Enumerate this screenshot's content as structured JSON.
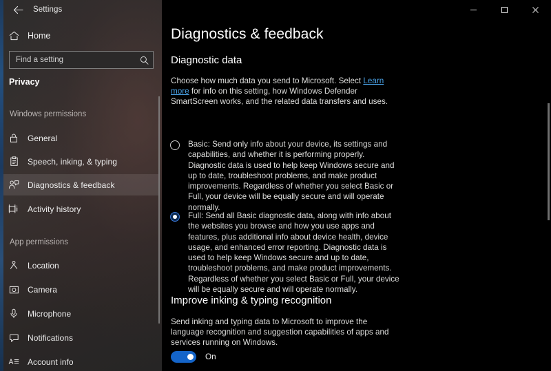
{
  "window": {
    "title": "Settings",
    "back_icon": "back-arrow-icon",
    "controls": {
      "minimize": "minimize-icon",
      "maximize": "maximize-icon",
      "close": "close-icon"
    }
  },
  "sidebar": {
    "home_label": "Home",
    "home_icon": "home-icon",
    "search": {
      "placeholder": "Find a setting",
      "value": "",
      "icon": "search-icon"
    },
    "category": "Privacy",
    "groups": [
      {
        "label": "Windows permissions",
        "items": [
          {
            "label": "General",
            "icon": "lock-icon",
            "selected": false
          },
          {
            "label": "Speech, inking, & typing",
            "icon": "clipboard-icon",
            "selected": false
          },
          {
            "label": "Diagnostics & feedback",
            "icon": "person-feedback-icon",
            "selected": true
          },
          {
            "label": "Activity history",
            "icon": "activity-history-icon",
            "selected": false
          }
        ]
      },
      {
        "label": "App permissions",
        "items": [
          {
            "label": "Location",
            "icon": "location-icon",
            "selected": false
          },
          {
            "label": "Camera",
            "icon": "camera-icon",
            "selected": false
          },
          {
            "label": "Microphone",
            "icon": "microphone-icon",
            "selected": false
          },
          {
            "label": "Notifications",
            "icon": "notification-icon",
            "selected": false
          },
          {
            "label": "Account info",
            "icon": "account-info-icon",
            "selected": false
          }
        ]
      }
    ]
  },
  "main": {
    "page_title": "Diagnostics & feedback",
    "diagnostic_data": {
      "section_title": "Diagnostic data",
      "intro_before_link": "Choose how much data you send to Microsoft. Select ",
      "link_text": "Learn more",
      "intro_after_link": " for info on this setting, how Windows Defender SmartScreen works, and the related data transfers and uses.",
      "options": [
        {
          "id": "basic",
          "selected": false,
          "text": "Basic: Send only info about your device, its settings and capabilities, and whether it is performing properly. Diagnostic data is used to help keep Windows secure and up to date, troubleshoot problems, and make product improvements. Regardless of whether you select Basic or Full, your device will be equally secure and will operate normally."
        },
        {
          "id": "full",
          "selected": true,
          "text": "Full: Send all Basic diagnostic data, along with info about the websites you browse and how you use apps and features, plus additional info about device health, device usage, and enhanced error reporting. Diagnostic data is used to help keep Windows secure and up to date, troubleshoot problems, and make product improvements. Regardless of whether you select Basic or Full, your device will be equally secure and will operate normally."
        }
      ]
    },
    "inking": {
      "section_title": "Improve inking & typing recognition",
      "description": "Send inking and typing data to Microsoft to improve the language recognition and suggestion capabilities of apps and services running on Windows.",
      "toggle_state": "On",
      "toggle_on": true
    }
  },
  "colors": {
    "accent": "#1464c8",
    "link": "#4aa3e8",
    "main_bg": "#000000",
    "sidebar_bg": "#332f2e"
  }
}
